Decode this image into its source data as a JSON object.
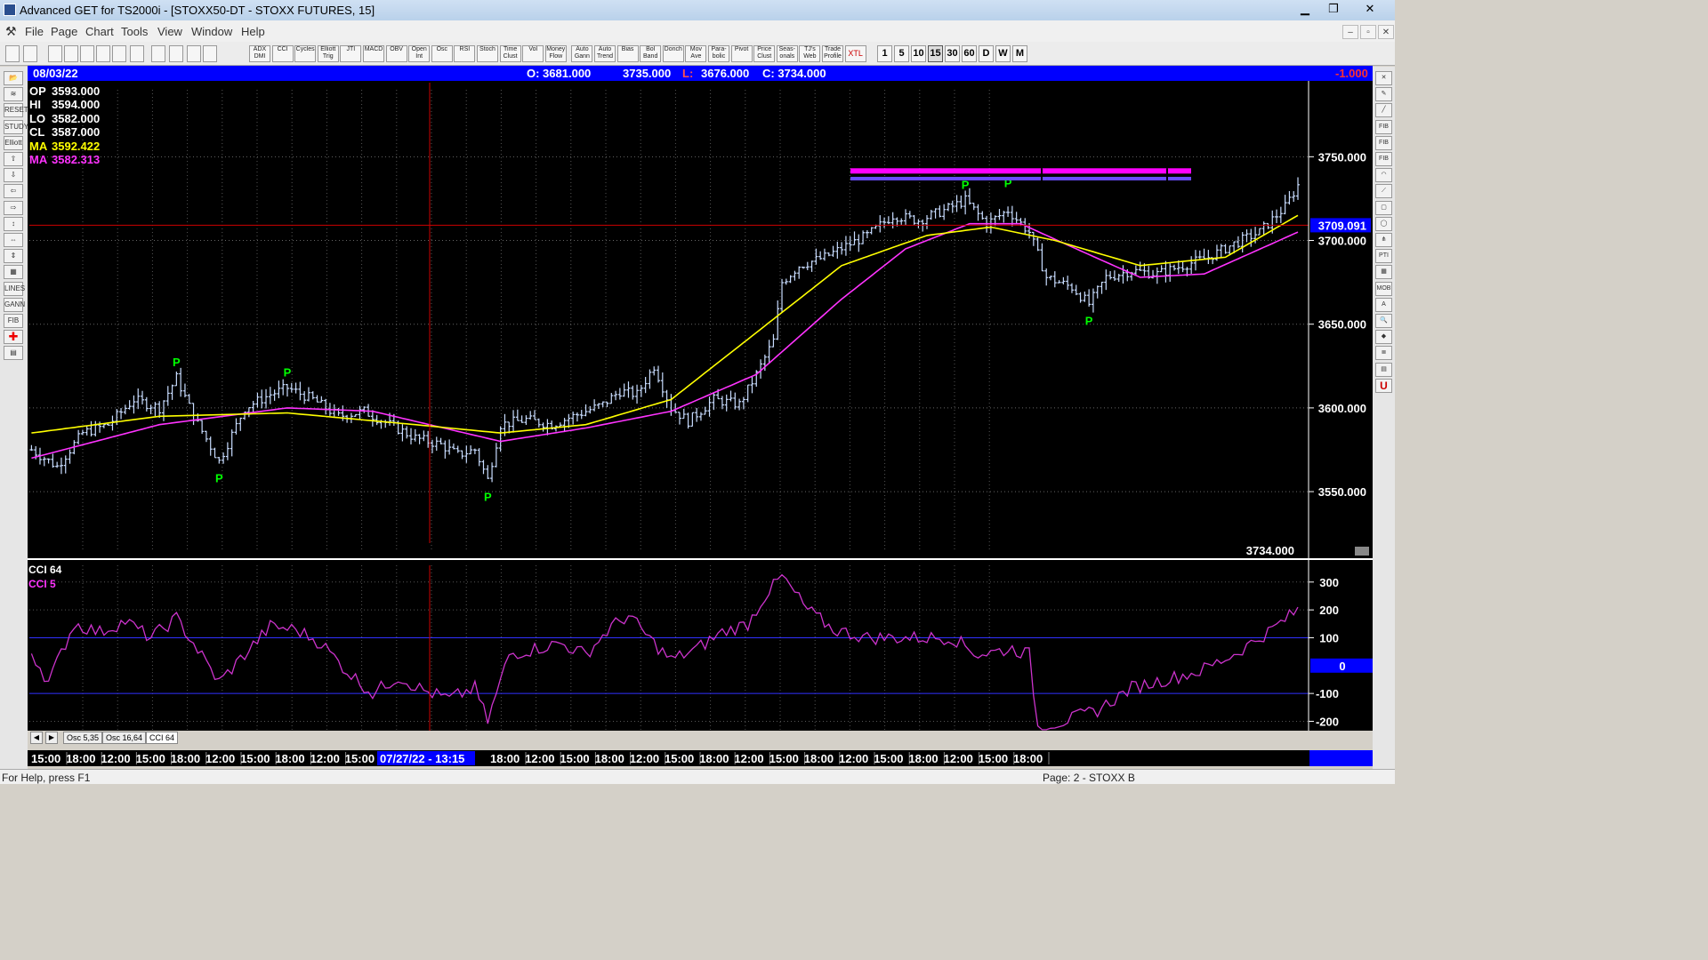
{
  "window": {
    "title": "Advanced GET for TS2000i - [STOXX50-DT - STOXX FUTURES, 15]",
    "minimize": "▁",
    "restore": "❐",
    "close": "✕"
  },
  "menu": {
    "items": [
      "File",
      "Page",
      "Chart",
      "Tools",
      "View",
      "Window",
      "Help"
    ],
    "mdi_minimize": "–",
    "mdi_restore": "▫",
    "mdi_close": "✕"
  },
  "toolbar": {
    "studies": [
      "ADX DMI",
      "CCI",
      "Cycles",
      "Elliott Trig",
      "JTI",
      "MACD",
      "OBV",
      "Open Int",
      "Osc",
      "RSI",
      "Stoch",
      "Time Clust",
      "Vol",
      "Money Flow",
      "Auto Gann",
      "Auto Trend",
      "Bias",
      "Bol Band",
      "Donch",
      "Mov Ave",
      "Para- bolic",
      "Pivot",
      "Price Clust",
      "Seas- onals",
      "TJ's Web",
      "Trade Profile",
      "XTL"
    ],
    "intervals": [
      "1",
      "5",
      "10",
      "15",
      "30",
      "60",
      "D",
      "W",
      "M"
    ]
  },
  "infobar": {
    "date": "08/03/22",
    "open": "O: 3681.000",
    "high": "3735.000",
    "low_label": "L:",
    "low": "3676.000",
    "close": "C: 3734.000",
    "change": "-1.000"
  },
  "legend": {
    "op_label": "OP",
    "op": "3593.000",
    "hi_label": "HI",
    "hi": "3594.000",
    "lo_label": "LO",
    "lo": "3582.000",
    "cl_label": "CL",
    "cl": "3587.000",
    "ma1_label": "MA",
    "ma1": "3592.422",
    "ma2_label": "MA",
    "ma2": "3582.313"
  },
  "colors": {
    "background": "#000000",
    "price_bars": "#c8dcff",
    "ma_fast": "#ffff00",
    "ma_slow": "#ff33ff",
    "cci": "#cc33cc",
    "pivot": "#00ff00",
    "cursor": "#cc0000",
    "accent_blue": "#0000ff",
    "band": "#ff00ff"
  },
  "chart_data": [
    {
      "type": "candlestick",
      "title": "STOXX50-DT - STOXX FUTURES, 15",
      "y_ticks": [
        "3750.000",
        "3700.000",
        "3650.000",
        "3600.000",
        "3550.000"
      ],
      "ylim": [
        3515,
        3790
      ],
      "cursor_price": "3709.091",
      "last_price": "3734.000",
      "pivot_label": "P",
      "pivots": [
        {
          "bar": 34,
          "price": 3620,
          "side": "high"
        },
        {
          "bar": 44,
          "price": 3564,
          "side": "low"
        },
        {
          "bar": 60,
          "price": 3614,
          "side": "high"
        },
        {
          "bar": 107,
          "price": 3553,
          "side": "low"
        },
        {
          "bar": 219,
          "price": 3726,
          "side": "high"
        },
        {
          "bar": 229,
          "price": 3727,
          "side": "high"
        },
        {
          "bar": 248,
          "price": 3658,
          "side": "low"
        }
      ],
      "band_levels": [
        3741,
        3738
      ],
      "price_keypoints": [
        [
          0,
          3575
        ],
        [
          6,
          3565
        ],
        [
          12,
          3585
        ],
        [
          18,
          3590
        ],
        [
          24,
          3605
        ],
        [
          30,
          3600
        ],
        [
          34,
          3618
        ],
        [
          38,
          3595
        ],
        [
          44,
          3568
        ],
        [
          50,
          3600
        ],
        [
          56,
          3608
        ],
        [
          60,
          3612
        ],
        [
          66,
          3605
        ],
        [
          72,
          3595
        ],
        [
          78,
          3598
        ],
        [
          84,
          3590
        ],
        [
          90,
          3582
        ],
        [
          96,
          3578
        ],
        [
          100,
          3572
        ],
        [
          104,
          3575
        ],
        [
          107,
          3557
        ],
        [
          110,
          3590
        ],
        [
          116,
          3593
        ],
        [
          122,
          3590
        ],
        [
          128,
          3596
        ],
        [
          134,
          3602
        ],
        [
          138,
          3610
        ],
        [
          142,
          3608
        ],
        [
          146,
          3625
        ],
        [
          150,
          3600
        ],
        [
          154,
          3592
        ],
        [
          160,
          3605
        ],
        [
          166,
          3602
        ],
        [
          170,
          3620
        ],
        [
          174,
          3640
        ],
        [
          176,
          3675
        ],
        [
          180,
          3685
        ],
        [
          186,
          3690
        ],
        [
          192,
          3698
        ],
        [
          196,
          3703
        ],
        [
          202,
          3715
        ],
        [
          208,
          3712
        ],
        [
          214,
          3718
        ],
        [
          219,
          3724
        ],
        [
          224,
          3710
        ],
        [
          229,
          3718
        ],
        [
          234,
          3705
        ],
        [
          238,
          3678
        ],
        [
          244,
          3672
        ],
        [
          248,
          3662
        ],
        [
          252,
          3678
        ],
        [
          258,
          3682
        ],
        [
          264,
          3680
        ],
        [
          270,
          3685
        ],
        [
          276,
          3690
        ],
        [
          282,
          3698
        ],
        [
          288,
          3705
        ],
        [
          294,
          3720
        ],
        [
          297,
          3733
        ]
      ],
      "ma_fast_keypoints": [
        [
          0,
          3585
        ],
        [
          30,
          3595
        ],
        [
          60,
          3597
        ],
        [
          90,
          3590
        ],
        [
          110,
          3585
        ],
        [
          130,
          3590
        ],
        [
          150,
          3605
        ],
        [
          170,
          3645
        ],
        [
          190,
          3685
        ],
        [
          210,
          3703
        ],
        [
          225,
          3708
        ],
        [
          240,
          3700
        ],
        [
          260,
          3685
        ],
        [
          280,
          3690
        ],
        [
          297,
          3715
        ]
      ],
      "ma_slow_keypoints": [
        [
          0,
          3570
        ],
        [
          30,
          3590
        ],
        [
          60,
          3600
        ],
        [
          80,
          3598
        ],
        [
          110,
          3580
        ],
        [
          130,
          3588
        ],
        [
          150,
          3598
        ],
        [
          170,
          3620
        ],
        [
          190,
          3665
        ],
        [
          205,
          3695
        ],
        [
          220,
          3710
        ],
        [
          232,
          3710
        ],
        [
          245,
          3695
        ],
        [
          260,
          3678
        ],
        [
          275,
          3680
        ],
        [
          297,
          3705
        ]
      ]
    },
    {
      "type": "line",
      "series": [
        {
          "name": "CCI 64"
        },
        {
          "name": "CCI  5"
        }
      ],
      "y_ticks": [
        "300",
        "200",
        "100",
        "0",
        "-100",
        "-200"
      ],
      "ylim": [
        -240,
        360
      ],
      "zero_label": "0",
      "cci_keypoints": [
        [
          0,
          50
        ],
        [
          4,
          -60
        ],
        [
          10,
          150
        ],
        [
          16,
          120
        ],
        [
          22,
          160
        ],
        [
          28,
          100
        ],
        [
          34,
          170
        ],
        [
          38,
          80
        ],
        [
          44,
          -60
        ],
        [
          50,
          40
        ],
        [
          56,
          140
        ],
        [
          62,
          130
        ],
        [
          68,
          80
        ],
        [
          74,
          -20
        ],
        [
          80,
          -100
        ],
        [
          86,
          -40
        ],
        [
          92,
          -90
        ],
        [
          98,
          -120
        ],
        [
          104,
          -80
        ],
        [
          107,
          -200
        ],
        [
          112,
          40
        ],
        [
          118,
          60
        ],
        [
          124,
          80
        ],
        [
          130,
          40
        ],
        [
          136,
          140
        ],
        [
          140,
          180
        ],
        [
          146,
          80
        ],
        [
          150,
          20
        ],
        [
          156,
          60
        ],
        [
          162,
          120
        ],
        [
          168,
          150
        ],
        [
          172,
          250
        ],
        [
          176,
          320
        ],
        [
          182,
          200
        ],
        [
          188,
          130
        ],
        [
          196,
          100
        ],
        [
          206,
          100
        ],
        [
          216,
          100
        ],
        [
          222,
          40
        ],
        [
          230,
          60
        ],
        [
          234,
          40
        ],
        [
          236,
          -220
        ],
        [
          242,
          -200
        ],
        [
          250,
          -160
        ],
        [
          258,
          -80
        ],
        [
          266,
          -50
        ],
        [
          274,
          -20
        ],
        [
          282,
          40
        ],
        [
          290,
          120
        ],
        [
          297,
          200
        ]
      ]
    }
  ],
  "time_axis": {
    "labels": [
      "15:00",
      "18:00",
      "12:00",
      "15:00",
      "18:00",
      "12:00",
      "15:00",
      "18:00",
      "12:00",
      "15:00",
      "07/27/22 - 13:15",
      "18:00",
      "12:00",
      "15:00",
      "18:00",
      "12:00",
      "15:00",
      "18:00",
      "12:00",
      "15:00",
      "18:00",
      "12:00",
      "15:00",
      "18:00",
      "12:00",
      "15:00",
      "18:00"
    ]
  },
  "tabs": {
    "items": [
      "Osc 5,35",
      "Osc 16,64",
      "CCI 64"
    ],
    "prev": "◀",
    "next": "▶"
  },
  "status": {
    "help": "For Help, press F1",
    "page": "Page: 2 - STOXX B"
  }
}
